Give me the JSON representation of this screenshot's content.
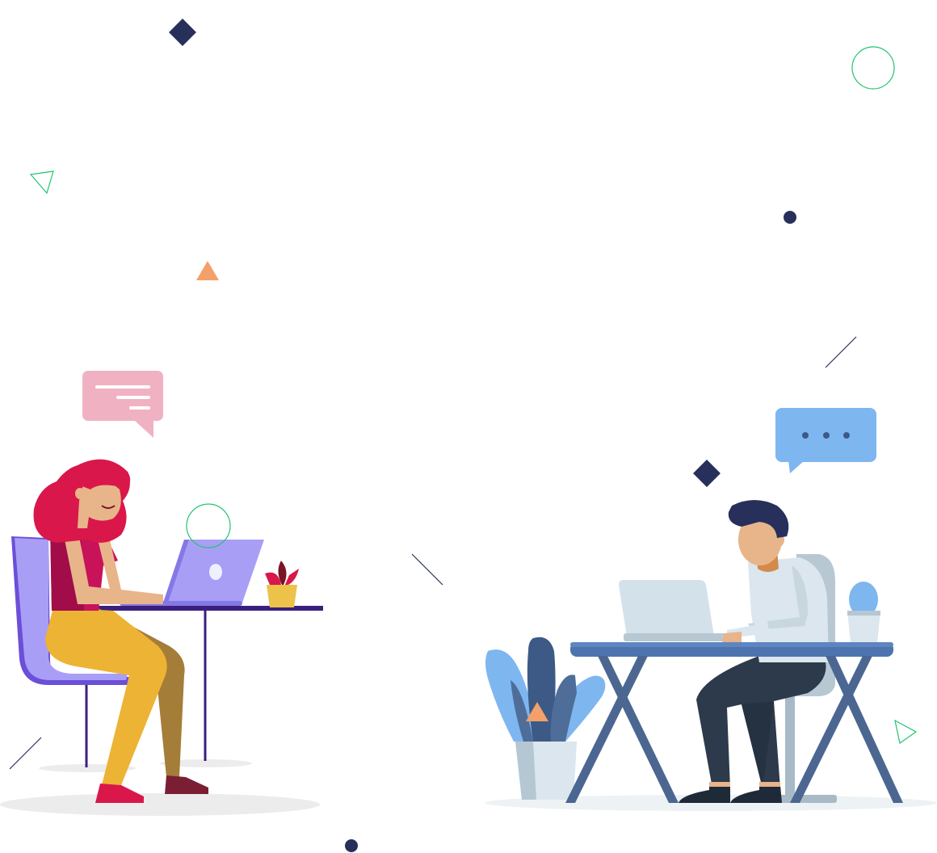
{
  "scene": {
    "description_labels": {
      "left_person": "woman",
      "right_person": "man"
    },
    "colors": {
      "navy": "#26305a",
      "coral": "#f5a06a",
      "green_outline": "#21c46f",
      "pink_bubble": "#f0b2c3",
      "blue_bubble": "#7eb6f0",
      "purple_chair": "#a99ef6",
      "red_hair": "#d9174a",
      "mustard": "#ecb334",
      "desk_blue": "#4e74b0",
      "dark_slate": "#2c3a4b",
      "light_gray_shadow": "#ececec"
    },
    "icons": [
      "diamond-icon",
      "circle-outline-icon",
      "triangle-outline-icon",
      "triangle-filled-icon",
      "dot-icon",
      "line-icon",
      "chat-bubble-icon",
      "typing-bubble-icon"
    ]
  }
}
